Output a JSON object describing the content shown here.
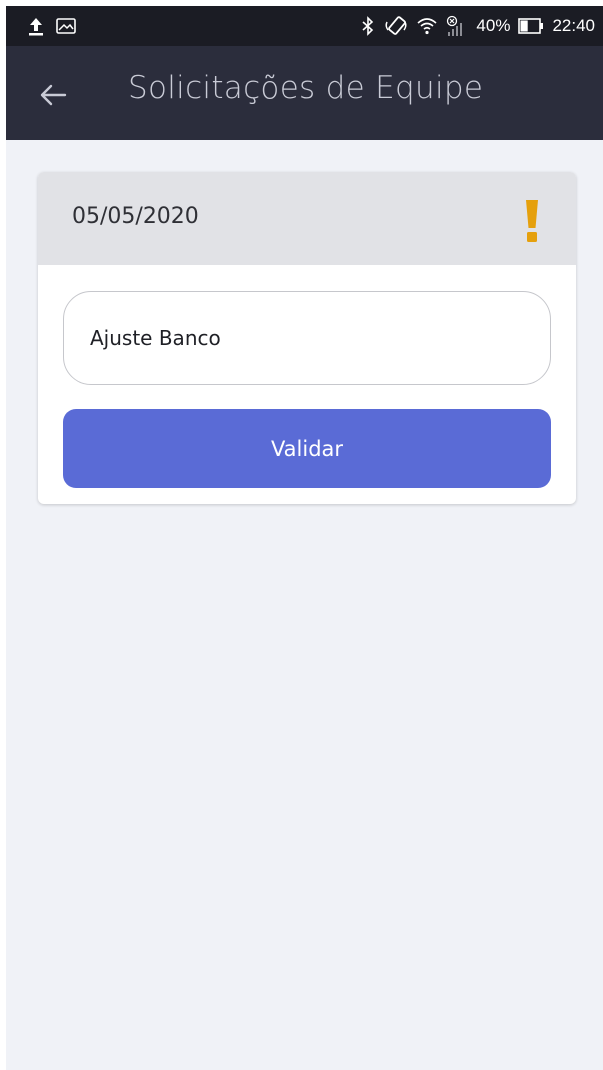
{
  "status_bar": {
    "left_icons": [
      "upload-icon",
      "image-icon"
    ],
    "right_icons": [
      "bluetooth-icon",
      "vibrate-icon",
      "wifi-icon",
      "signal-icon"
    ],
    "battery_percent": "40%",
    "battery_level": 0.4,
    "time": "22:40"
  },
  "app_bar": {
    "back_icon": "arrow-left-icon",
    "title": "Solicitações de Equipe"
  },
  "card": {
    "date": "05/05/2020",
    "alert_icon": "exclamation-icon",
    "input_value": "Ajuste Banco",
    "button_label": "Validar"
  },
  "colors": {
    "status_bar_bg": "#1b1c24",
    "app_bar_bg": "#2b2d3c",
    "page_bg": "#f0f2f7",
    "card_header_bg": "#e1e2e6",
    "alert": "#e5a00d",
    "button_bg": "#5a6bd6"
  }
}
